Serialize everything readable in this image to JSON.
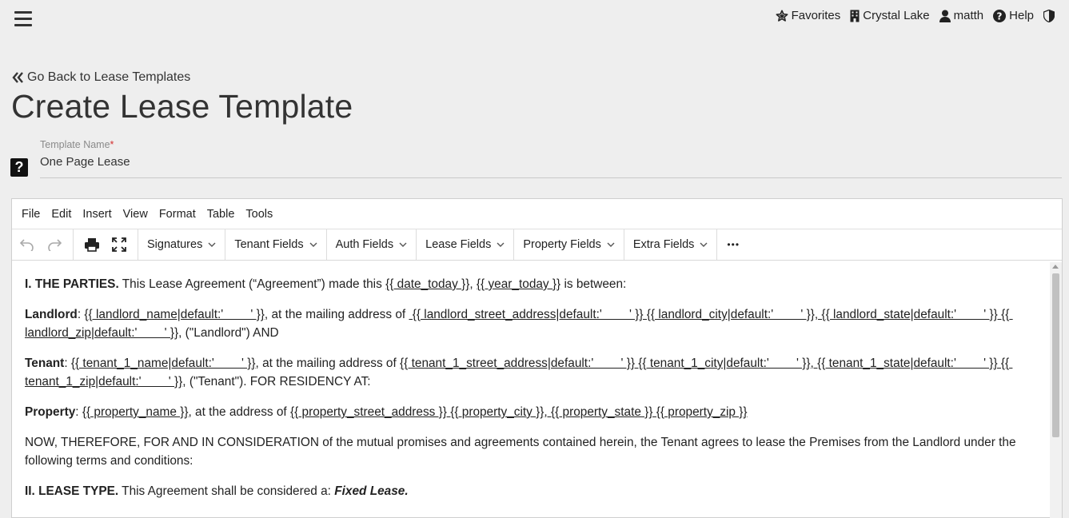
{
  "topnav": {
    "favorites": "Favorites",
    "location": "Crystal Lake",
    "user": "matth",
    "help": "Help"
  },
  "back_link": "Go Back to Lease Templates",
  "page_title": "Create Lease Template",
  "template_name": {
    "label": "Template Name",
    "required_mark": "*",
    "value": "One Page Lease"
  },
  "editor": {
    "menu": [
      "File",
      "Edit",
      "Insert",
      "View",
      "Format",
      "Table",
      "Tools"
    ],
    "toolbar": {
      "dropdowns": [
        "Signatures",
        "Tenant Fields",
        "Auth Fields",
        "Lease Fields",
        "Property Fields",
        "Extra Fields"
      ],
      "more": "•••"
    },
    "content": {
      "p1": {
        "heading": "I. THE PARTIES.",
        "text1": " This Lease Agreement (“Agreement”) made this ",
        "var1": "{{ date_today }}",
        "sep": ", ",
        "var2": "{{ year_today }}",
        "text2": " is between:"
      },
      "p2": {
        "heading": "Landlord",
        "text1": ": ",
        "var1": "{{ landlord_name|default:'        ' }}",
        "text2": ", at the mailing address of ",
        "var2": " {{ landlord_street_address|default:'        ' }} {{ landlord_city|default:'        ' }}, {{ landlord_state|default:'        ' }} {{ landlord_zip|default:'        ' }}",
        "text3": ", (\"Landlord\") AND"
      },
      "p3": {
        "heading": "Tenant",
        "text1": ": ",
        "var1": "{{ tenant_1_name|default:'        ' }}",
        "text2": ", at the mailing address of ",
        "var2": "{{ tenant_1_street_address|default:'        ' }} {{ tenant_1_city|default:'        ' }}, {{ tenant_1_state|default:'        ' }} {{ tenant_1_zip|default:'        ' }}",
        "text3": ", (\"Tenant\"). FOR RESIDENCY AT:"
      },
      "p4": {
        "heading": "Property",
        "text1": ": ",
        "var1": "{{ property_name }}",
        "text2": ", at the address of ",
        "var2": "{{ property_street_address }} {{ property_city }}, {{ property_state }} {{ property_zip }}"
      },
      "p5": "NOW, THEREFORE, FOR AND IN CONSIDERATION of the mutual promises and agreements contained herein, the Tenant agrees to lease the Premises from the Landlord under the following terms and conditions:",
      "p6": {
        "heading": "II. LEASE TYPE.",
        "text1": " This Agreement shall be considered a: ",
        "emph": "Fixed Lease."
      }
    }
  }
}
